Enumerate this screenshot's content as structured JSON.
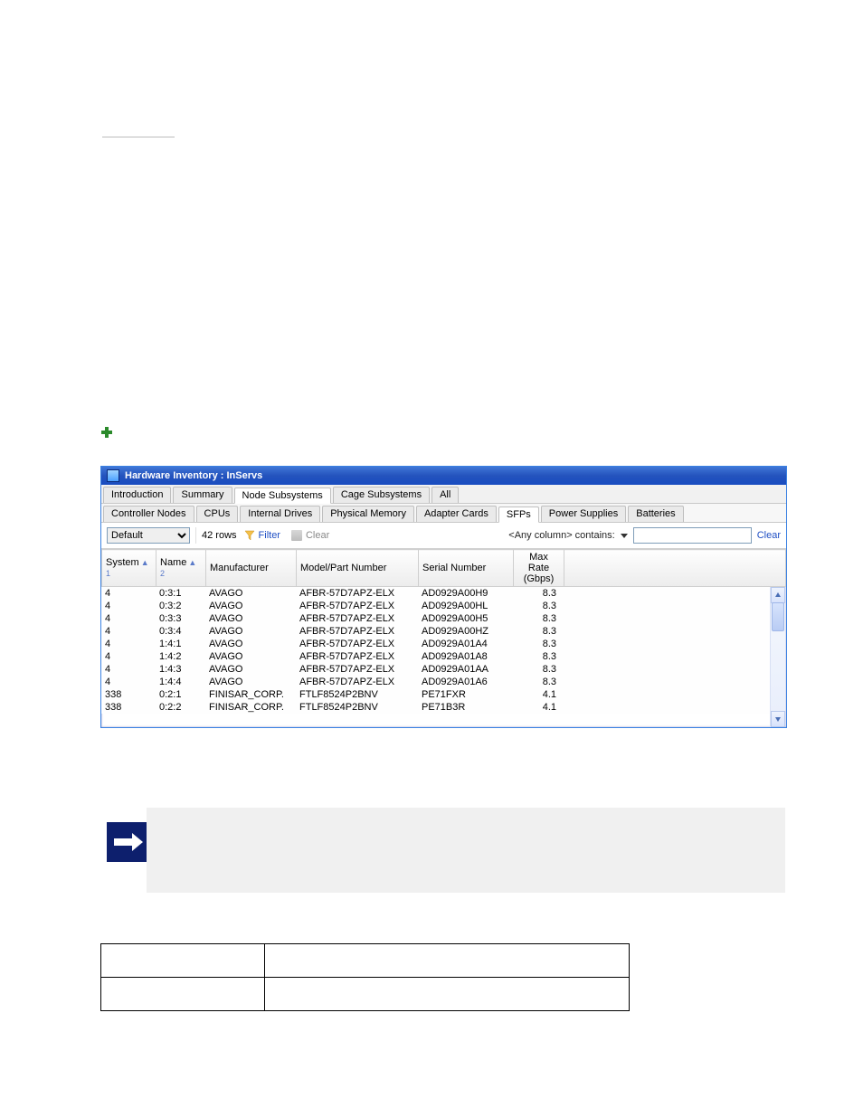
{
  "window": {
    "title": "Hardware Inventory : InServs"
  },
  "tabs": {
    "primary": [
      {
        "label": "Introduction",
        "active": false
      },
      {
        "label": "Summary",
        "active": false
      },
      {
        "label": "Node Subsystems",
        "active": true
      },
      {
        "label": "Cage Subsystems",
        "active": false
      },
      {
        "label": "All",
        "active": false
      }
    ],
    "secondary": [
      {
        "label": "Controller Nodes",
        "active": false
      },
      {
        "label": "CPUs",
        "active": false
      },
      {
        "label": "Internal Drives",
        "active": false
      },
      {
        "label": "Physical Memory",
        "active": false
      },
      {
        "label": "Adapter Cards",
        "active": false
      },
      {
        "label": "SFPs",
        "active": true
      },
      {
        "label": "Power Supplies",
        "active": false
      },
      {
        "label": "Batteries",
        "active": false
      }
    ]
  },
  "toolbar": {
    "preset_selected": "Default",
    "rows_label": "42 rows",
    "filter_label": "Filter",
    "clear_label": "Clear",
    "right_label": "<Any column> contains:",
    "search_placeholder": "",
    "clear_link": "Clear"
  },
  "columns": {
    "system": "System",
    "system_sort": "▲ 1",
    "name": "Name",
    "name_sort": "▲ 2",
    "manufacturer": "Manufacturer",
    "model": "Model/Part Number",
    "serial": "Serial Number",
    "rate": "Max Rate (Gbps)"
  },
  "rows": [
    {
      "system": "4",
      "name": "0:3:1",
      "manufacturer": "AVAGO",
      "model": "AFBR-57D7APZ-ELX",
      "serial": "AD0929A00H9",
      "rate": "8.3"
    },
    {
      "system": "4",
      "name": "0:3:2",
      "manufacturer": "AVAGO",
      "model": "AFBR-57D7APZ-ELX",
      "serial": "AD0929A00HL",
      "rate": "8.3"
    },
    {
      "system": "4",
      "name": "0:3:3",
      "manufacturer": "AVAGO",
      "model": "AFBR-57D7APZ-ELX",
      "serial": "AD0929A00H5",
      "rate": "8.3"
    },
    {
      "system": "4",
      "name": "0:3:4",
      "manufacturer": "AVAGO",
      "model": "AFBR-57D7APZ-ELX",
      "serial": "AD0929A00HZ",
      "rate": "8.3"
    },
    {
      "system": "4",
      "name": "1:4:1",
      "manufacturer": "AVAGO",
      "model": "AFBR-57D7APZ-ELX",
      "serial": "AD0929A01A4",
      "rate": "8.3"
    },
    {
      "system": "4",
      "name": "1:4:2",
      "manufacturer": "AVAGO",
      "model": "AFBR-57D7APZ-ELX",
      "serial": "AD0929A01A8",
      "rate": "8.3"
    },
    {
      "system": "4",
      "name": "1:4:3",
      "manufacturer": "AVAGO",
      "model": "AFBR-57D7APZ-ELX",
      "serial": "AD0929A01AA",
      "rate": "8.3"
    },
    {
      "system": "4",
      "name": "1:4:4",
      "manufacturer": "AVAGO",
      "model": "AFBR-57D7APZ-ELX",
      "serial": "AD0929A01A6",
      "rate": "8.3"
    },
    {
      "system": "338",
      "name": "0:2:1",
      "manufacturer": "FINISAR_CORP.",
      "model": "FTLF8524P2BNV",
      "serial": "PE71FXR",
      "rate": "4.1"
    },
    {
      "system": "338",
      "name": "0:2:2",
      "manufacturer": "FINISAR_CORP.",
      "model": "FTLF8524P2BNV",
      "serial": "PE71B3R",
      "rate": "4.1"
    }
  ]
}
